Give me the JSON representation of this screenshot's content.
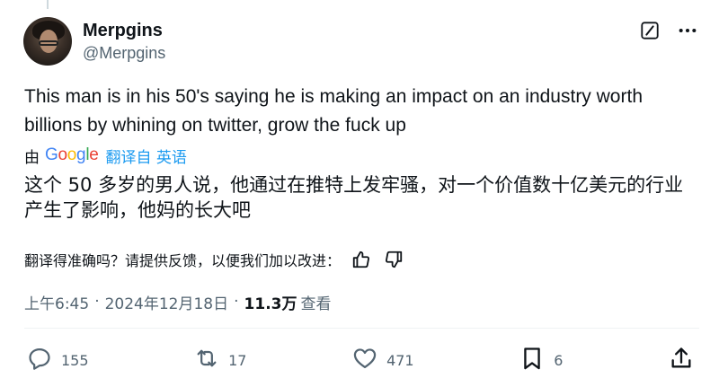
{
  "author": {
    "display_name": "Merpgins",
    "handle": "@Merpgins"
  },
  "tweet": {
    "text": "This man is in his 50's saying he is making an impact on an industry worth billions by whining on twitter, grow the fuck up"
  },
  "translation": {
    "by_label": "由",
    "provider": "Google",
    "source_label": "翻译自 英语",
    "text": "这个 50 多岁的男人说，他通过在推特上发牢骚，对一个价值数十亿美元的行业产生了影响，他妈的长大吧",
    "feedback_prompt": "翻译得准确吗？请提供反馈，以便我们加以改进："
  },
  "meta": {
    "time": "上午6:45",
    "date": "2024年12月18日",
    "separator": "·",
    "views_count": "11.3万",
    "views_label": "查看"
  },
  "actions": {
    "replies": "155",
    "reposts": "17",
    "likes": "471",
    "bookmarks": "6"
  },
  "icons": {
    "grok": "grok-icon",
    "more": "more-icon",
    "reply": "reply-icon",
    "repost": "repost-icon",
    "like": "heart-icon",
    "bookmark": "bookmark-icon",
    "share": "share-icon",
    "thumbs_up": "thumbs-up-icon",
    "thumbs_down": "thumbs-down-icon"
  },
  "colors": {
    "text": "#0f1419",
    "secondary": "#536471",
    "link": "#1d9bf0"
  }
}
